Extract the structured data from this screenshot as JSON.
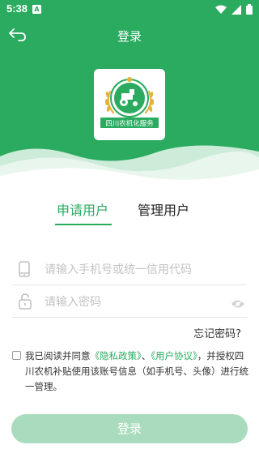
{
  "status_bar": {
    "time": "5:38",
    "notification": "A"
  },
  "topbar": {
    "title": "登录"
  },
  "logo": {
    "banner_text": "四川农机化服务"
  },
  "tabs": [
    {
      "label": "申请用户",
      "active": true
    },
    {
      "label": "管理用户",
      "active": false
    }
  ],
  "form": {
    "phone_placeholder": "请输入手机号或统一信用代码",
    "password_placeholder": "请输入密码",
    "forgot_label": "忘记密码?"
  },
  "agreement": {
    "prefix": "我已阅读并同意",
    "privacy": "《隐私政策》",
    "sep": "、",
    "terms": "《用户协议》",
    "suffix": "，并授权四川农机补贴使用该账号信息（如手机号、头像）进行统一管理。",
    "checked": false
  },
  "login_button": {
    "label": "登录"
  },
  "colors": {
    "brand": "#2aab5f",
    "button_disabled": "#a9dcbe"
  },
  "icons": [
    "wifi-icon",
    "signal-icon",
    "battery-icon",
    "back-arrow-icon",
    "phone-icon",
    "lock-icon",
    "eye-icon"
  ]
}
